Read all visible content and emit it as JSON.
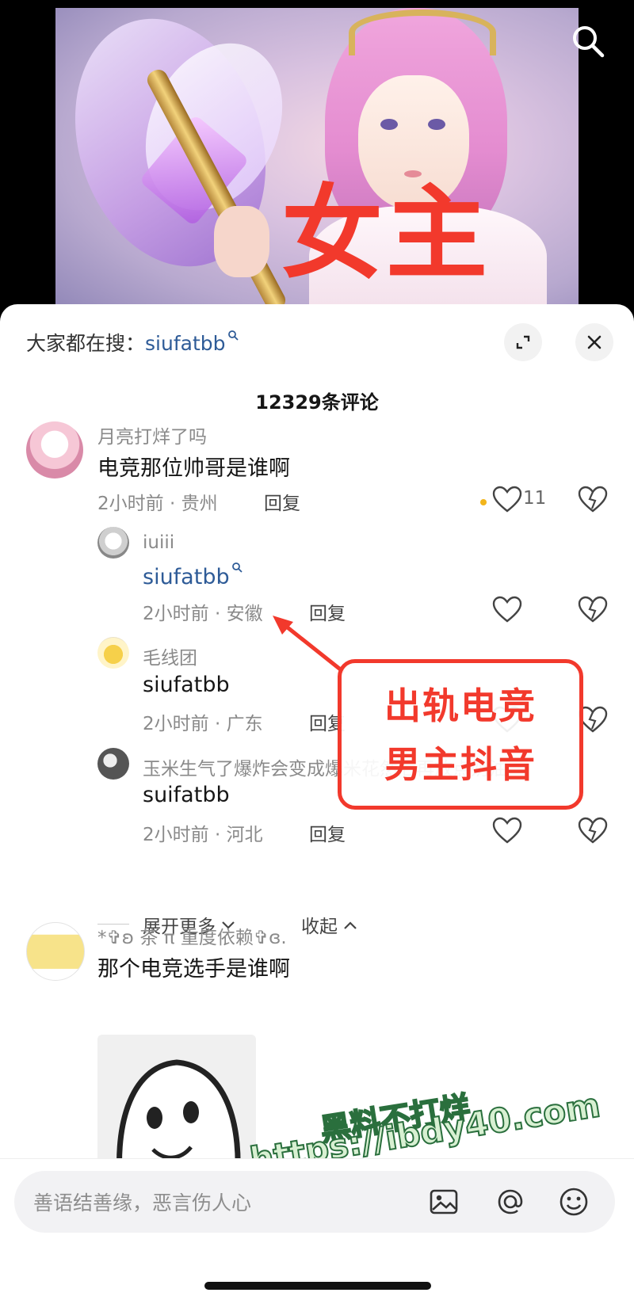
{
  "video": {
    "overlay_title": "女主",
    "search_icon": "search-icon"
  },
  "panel": {
    "search_hint_prefix": "大家都在搜：",
    "search_hint_keyword": "siufatbb",
    "expand_icon": "expand-icon",
    "close_icon": "close-icon",
    "comment_count": "12329条评论"
  },
  "comments": [
    {
      "user": "月亮打烊了吗",
      "text": "电竞那位帅哥是谁啊",
      "time_location": "2小时前 · 贵州",
      "reply_label": "回复",
      "likes": "11"
    },
    {
      "user": "iuiii",
      "text": "siufatbb",
      "time_location": "2小时前 · 安徽",
      "reply_label": "回复"
    },
    {
      "user": "毛线团",
      "text": "siufatbb",
      "time_location": "2小时前 · 广东",
      "reply_label": "回复"
    },
    {
      "user": "玉米生气了爆炸会变成爆米花然后再放点奶油",
      "text": "suifatbb",
      "time_location": "2小时前 · 河北",
      "reply_label": "回复"
    },
    {
      "user": "*✞ʚ 茶 π 重度依赖✞ɞ.",
      "text": "那个电竞选手是谁啊"
    }
  ],
  "thread_controls": {
    "expand_more": "展开更多",
    "collapse": "收起"
  },
  "annotation": {
    "line1": "出轨电竞",
    "line2": "男主抖音"
  },
  "watermark": {
    "line1": "黑料不打烊",
    "line2": "https://ibdy40.com"
  },
  "input": {
    "placeholder": "善语结善缘，恶言伤人心",
    "value": ""
  },
  "colors": {
    "accent_red": "#f2392c",
    "link_blue": "#2e5b97",
    "like_dot": "#f2b51b"
  }
}
